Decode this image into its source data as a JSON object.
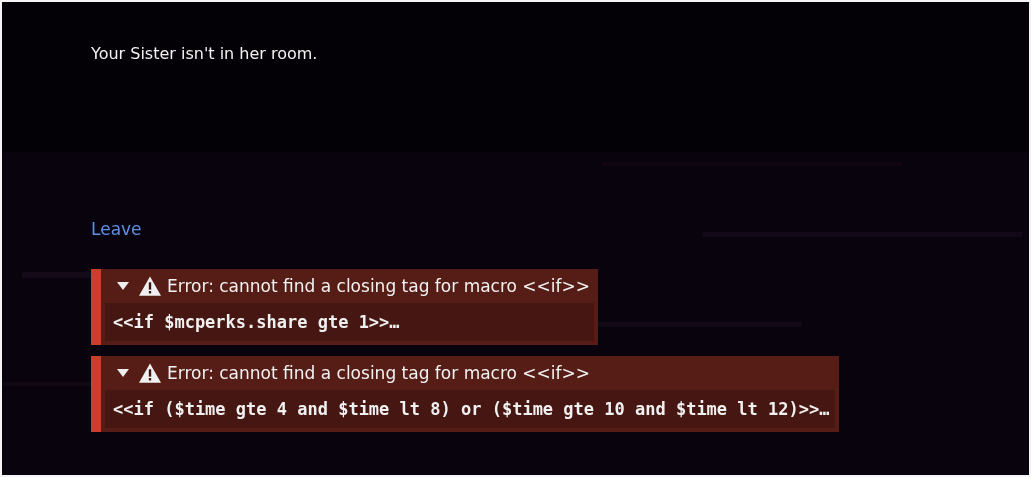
{
  "passage": {
    "text": "Your Sister isn't in her room."
  },
  "links": [
    {
      "label": "Leave"
    }
  ],
  "errors": [
    {
      "title": "Error: cannot find a closing tag for macro <<if>>",
      "source": "<<if $mcperks.share gte 1>>…",
      "expanded": true
    },
    {
      "title": "Error: cannot find a closing tag for macro <<if>>",
      "source": "<<if ($time gte 4 and $time lt 8) or ($time gte 10 and $time lt 12)>>…",
      "expanded": true
    }
  ]
}
